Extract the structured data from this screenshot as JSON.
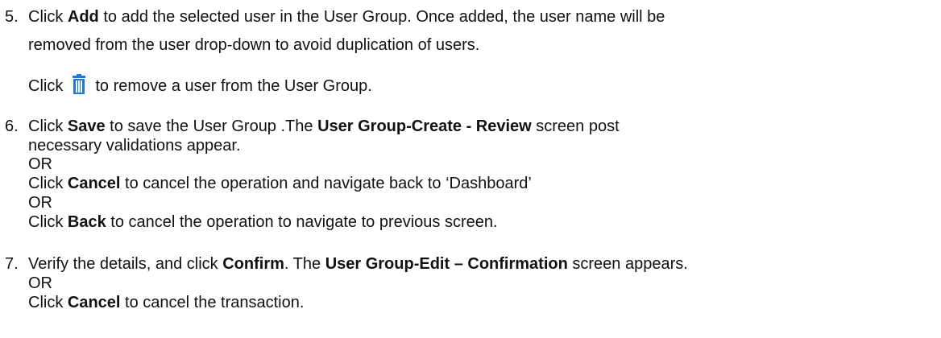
{
  "steps": [
    {
      "number": "5.",
      "line1": {
        "t1": "Click ",
        "b1": "Add",
        "t2": " to add the selected user in the User Group. Once added, the user name will be"
      },
      "line2": "removed from the user drop-down to avoid duplication of users.",
      "line3": {
        "t1": "Click",
        "icon": "trash-icon",
        "t2": "to remove a user from the User Group."
      }
    },
    {
      "number": "6.",
      "line1": {
        "t1": "Click ",
        "b1": "Save",
        "t2": " to save the User Group .The ",
        "b2": "User Group-Create - Review",
        "t3": " screen post"
      },
      "line2": "necessary validations appear.",
      "or1": "OR",
      "line4": {
        "t1": "Click ",
        "b1": "Cancel",
        "t2": " to cancel the operation and navigate back to ‘Dashboard’"
      },
      "or2": "OR",
      "line6": {
        "t1": "Click ",
        "b1": "Back",
        "t2": " to cancel the operation to navigate to previous screen."
      }
    },
    {
      "number": "7.",
      "line1": {
        "t1": " Verify the details, and click ",
        "b1": "Confirm",
        "t2": ". The ",
        "b2": "User Group-Edit – Confirmation",
        "t3": " screen appears."
      },
      "or1": "OR",
      "line3": {
        "t1": "Click ",
        "b1": "Cancel",
        "t2": " to cancel the transaction."
      }
    }
  ],
  "colors": {
    "icon_blue": "#1f7ad1",
    "text": "#111111"
  }
}
